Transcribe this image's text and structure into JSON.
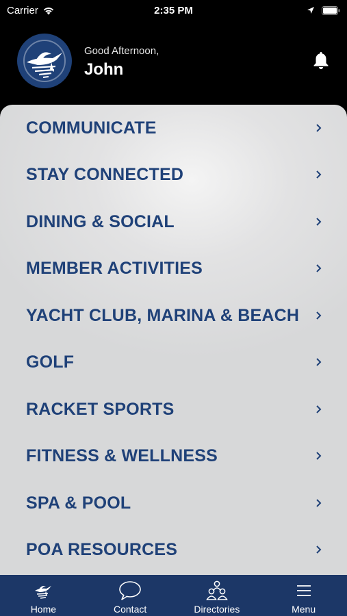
{
  "status_bar": {
    "carrier": "Carrier",
    "time": "2:35 PM",
    "icons": [
      "wifi-icon",
      "location-icon",
      "battery-icon"
    ]
  },
  "header": {
    "greeting": "Good Afternoon,",
    "name": "John",
    "logo_icon": "marlin-logo-icon",
    "bell_icon": "bell-icon"
  },
  "menu": {
    "items": [
      {
        "label": "COMMUNICATE"
      },
      {
        "label": "STAY CONNECTED"
      },
      {
        "label": "DINING & SOCIAL"
      },
      {
        "label": "MEMBER ACTIVITIES"
      },
      {
        "label": "YACHT CLUB, MARINA & BEACH"
      },
      {
        "label": "GOLF"
      },
      {
        "label": "RACKET SPORTS"
      },
      {
        "label": "FITNESS & WELLNESS"
      },
      {
        "label": "SPA & POOL"
      },
      {
        "label": "POA RESOURCES"
      }
    ]
  },
  "tab_bar": {
    "tabs": [
      {
        "label": "Home",
        "icon": "marlin-icon"
      },
      {
        "label": "Contact",
        "icon": "chat-bubble-icon"
      },
      {
        "label": "Directories",
        "icon": "people-group-icon"
      },
      {
        "label": "Menu",
        "icon": "hamburger-menu-icon"
      }
    ]
  },
  "colors": {
    "brand_navy": "#1f4178",
    "tab_bar": "#1c3767",
    "background": "#000000",
    "panel": "#dcdcdd"
  }
}
